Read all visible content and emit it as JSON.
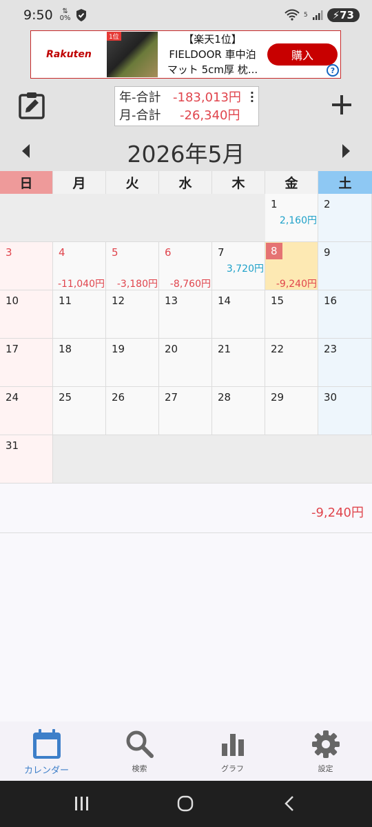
{
  "status_bar": {
    "time": "9:50",
    "data_percent": "0%",
    "signal_label": "5",
    "battery": "73"
  },
  "ad": {
    "brand": "Rakuten",
    "image_tag": "1位",
    "line1": "【楽天1位】",
    "line2": "FIELDOOR 車中泊",
    "line3": "マット 5cm厚 枕...",
    "buy_label": "購入",
    "info": "?"
  },
  "summary": {
    "year_label": "年-合計",
    "year_value": "-183,013円",
    "month_label": "月-合計",
    "month_value": "-26,340円"
  },
  "header": {
    "month_title": "2026年5月"
  },
  "weekdays": [
    "日",
    "月",
    "火",
    "水",
    "木",
    "金",
    "土"
  ],
  "days": {
    "d1": "1",
    "d2": "2",
    "d3": "3",
    "d4": "4",
    "d5": "5",
    "d6": "6",
    "d7": "7",
    "d8": "8",
    "d9": "9",
    "d10": "10",
    "d11": "11",
    "d12": "12",
    "d13": "13",
    "d14": "14",
    "d15": "15",
    "d16": "16",
    "d17": "17",
    "d18": "18",
    "d19": "19",
    "d20": "20",
    "d21": "21",
    "d22": "22",
    "d23": "23",
    "d24": "24",
    "d25": "25",
    "d26": "26",
    "d27": "27",
    "d28": "28",
    "d29": "29",
    "d30": "30",
    "d31": "31"
  },
  "amounts": {
    "d1_income": "2,160円",
    "d4_expense": "-11,040円",
    "d5_expense": "-3,180円",
    "d6_expense": "-8,760円",
    "d7_income": "3,720円",
    "d8_expense": "-9,240円"
  },
  "day_summary": {
    "value": "-9,240円"
  },
  "bottom_nav": [
    {
      "label": "カレンダー",
      "icon": "calendar-icon"
    },
    {
      "label": "検索",
      "icon": "search-icon"
    },
    {
      "label": "グラフ",
      "icon": "bar-chart-icon"
    },
    {
      "label": "設定",
      "icon": "gear-icon"
    }
  ],
  "colors": {
    "accent": "#3d7fc9",
    "expense": "#e0454d",
    "income": "#1ea1c9",
    "today": "#fde9b3"
  }
}
